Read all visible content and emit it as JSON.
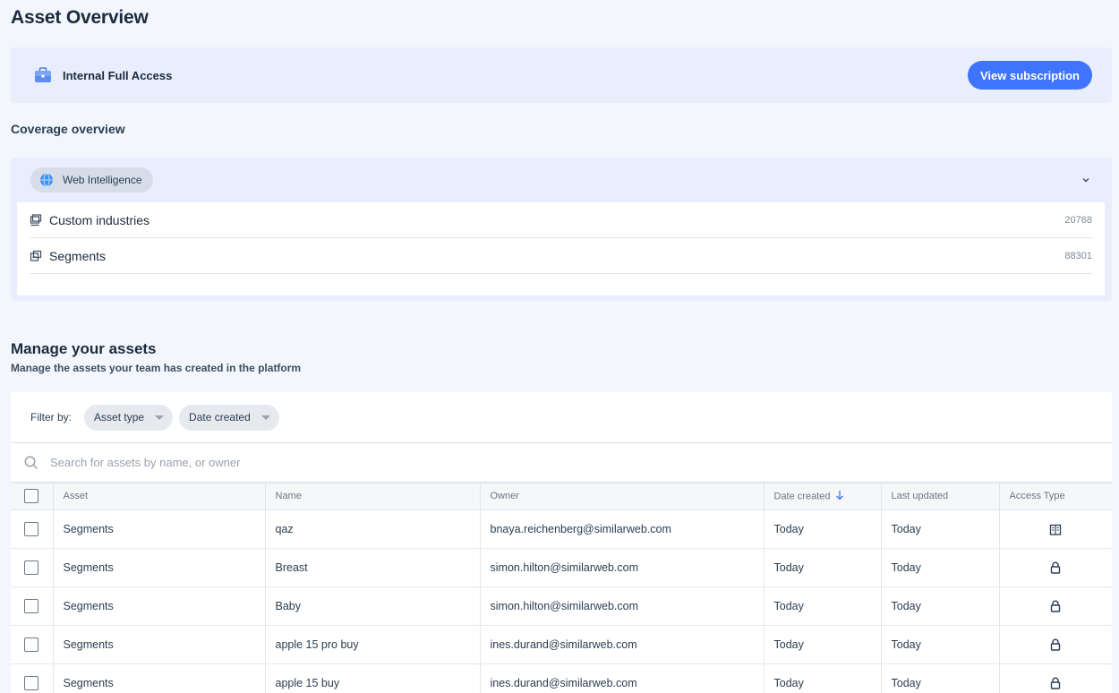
{
  "page": {
    "title": "Asset Overview"
  },
  "subscription": {
    "plan_name": "Internal Full Access",
    "button_label": "View subscription"
  },
  "coverage": {
    "title": "Coverage overview",
    "product": "Web Intelligence",
    "rows": [
      {
        "label": "Custom industries",
        "count": "20768"
      },
      {
        "label": "Segments",
        "count": "88301"
      }
    ]
  },
  "manage": {
    "title": "Manage your assets",
    "subtitle": "Manage the assets your team has created in the platform"
  },
  "filters": {
    "label": "Filter by:",
    "asset_type": "Asset type",
    "date_created": "Date created"
  },
  "search": {
    "placeholder": "Search for assets by name, or owner"
  },
  "table": {
    "headers": {
      "asset": "Asset",
      "name": "Name",
      "owner": "Owner",
      "date_created": "Date created",
      "last_updated": "Last updated",
      "access_type": "Access Type"
    },
    "rows": [
      {
        "asset": "Segments",
        "name": "qaz",
        "owner": "bnaya.reichenberg@similarweb.com",
        "date_created": "Today",
        "last_updated": "Today",
        "access": "building-icon"
      },
      {
        "asset": "Segments",
        "name": "Breast",
        "owner": "simon.hilton@similarweb.com",
        "date_created": "Today",
        "last_updated": "Today",
        "access": "lock-icon"
      },
      {
        "asset": "Segments",
        "name": "Baby",
        "owner": "simon.hilton@similarweb.com",
        "date_created": "Today",
        "last_updated": "Today",
        "access": "lock-icon"
      },
      {
        "asset": "Segments",
        "name": "apple 15 pro buy",
        "owner": "ines.durand@similarweb.com",
        "date_created": "Today",
        "last_updated": "Today",
        "access": "lock-icon"
      },
      {
        "asset": "Segments",
        "name": "apple 15 buy",
        "owner": "ines.durand@similarweb.com",
        "date_created": "Today",
        "last_updated": "Today",
        "access": "lock-icon"
      }
    ]
  },
  "colors": {
    "accent": "#3e74fe",
    "background": "#f3f6fc",
    "banner": "#e8eefb"
  }
}
